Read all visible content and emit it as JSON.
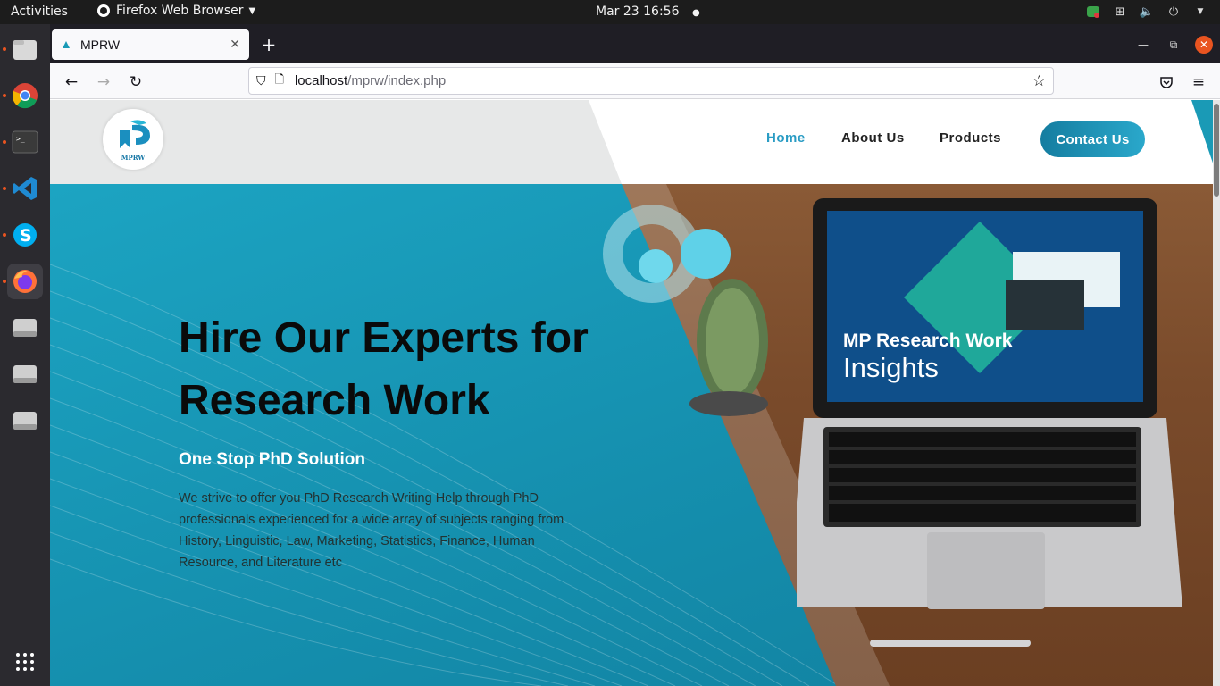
{
  "topbar": {
    "activities": "Activities",
    "app_name": "Firefox Web Browser",
    "clock": "Mar 23  16:56"
  },
  "dock": {
    "items": [
      "files-icon",
      "chrome-icon",
      "terminal-icon",
      "vscode-icon",
      "skype-icon",
      "firefox-icon",
      "drive-icon",
      "drive-icon",
      "drive-icon",
      "app-grid-icon"
    ]
  },
  "browser": {
    "tab_title": "MPRW",
    "url_host": "localhost",
    "url_path": "/mprw/index.php"
  },
  "site": {
    "logo_text": "MPRW",
    "nav": [
      "Home",
      "About Us",
      "Products"
    ],
    "contact_button": "Contact Us",
    "hero_title": "Hire Our Experts for Research Work",
    "hero_subtitle": "One Stop PhD Solution",
    "hero_description": "We strive to offer you PhD Research Writing Help through PhD professionals experienced for a wide array of subjects ranging from History, Linguistic, Law, Marketing, Statistics, Finance, Human Resource, and Literature etc",
    "screen_title_line1": "MP Research Work",
    "screen_title_line2": "Insights"
  },
  "colors": {
    "accent": "#1a9ab6",
    "ubuntu_orange": "#e95420",
    "nav_active": "#2a9cc4"
  }
}
